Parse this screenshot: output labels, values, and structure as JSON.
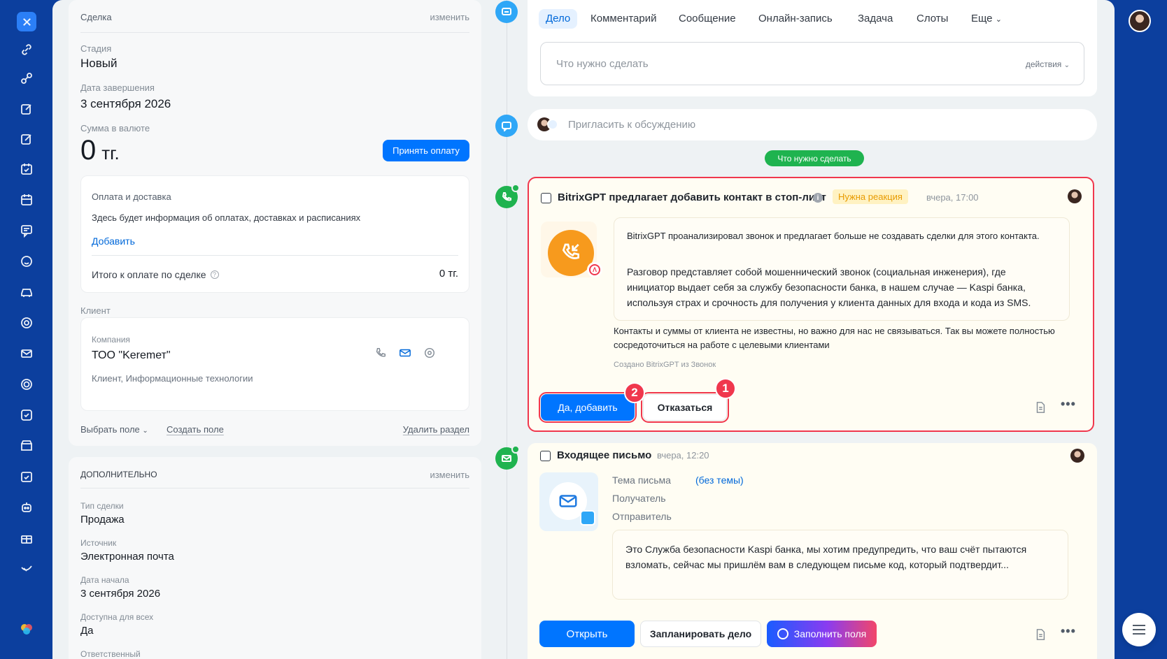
{
  "nav": {
    "icons": [
      "close-icon",
      "link-icon",
      "link-alt-icon",
      "edit-icon",
      "edit-alt-icon",
      "calendar-task-icon",
      "calendar-icon",
      "chat-icon",
      "feedback-icon",
      "car-icon",
      "support-icon",
      "mail-icon",
      "target-icon",
      "checklist-icon",
      "store-icon",
      "tasks-icon",
      "robot-icon",
      "gift-icon",
      "bird-icon",
      "bitrix-logo-icon"
    ]
  },
  "deal": {
    "section_title": "Сделка",
    "edit_label": "изменить",
    "stage_label": "Стадия",
    "stage_value": "Новый",
    "close_date_label": "Дата завершения",
    "close_date_value": "3 сентября 2026",
    "amount_label": "Сумма в валюте",
    "amount_value": "0",
    "amount_currency": "тг.",
    "accept_payment_button": "Принять оплату",
    "payment": {
      "title": "Оплата и доставка",
      "description": "Здесь будет информация об оплатах, доставках и расписаниях",
      "add_link": "Добавить",
      "total_label": "Итого к оплате по сделке",
      "total_value": "0 тг."
    },
    "client_label": "Клиент",
    "client": {
      "type_label": "Компания",
      "name": "ТОО \"Keremет\"",
      "description": "Клиент, Информационные технологии"
    },
    "select_field": "Выбрать поле",
    "create_field": "Создать поле",
    "delete_section": "Удалить раздел"
  },
  "extra": {
    "section_title": "ДОПОЛНИТЕЛЬНО",
    "edit_label": "изменить",
    "deal_type_label": "Тип сделки",
    "deal_type_value": "Продажа",
    "source_label": "Источник",
    "source_value": "Электронная почта",
    "start_date_label": "Дата начала",
    "start_date_value": "3 сентября 2026",
    "available_label": "Доступна для всех",
    "available_value": "Да",
    "responsible_label": "Ответственный"
  },
  "editor": {
    "tabs": [
      "Дело",
      "Комментарий",
      "Сообщение",
      "Онлайн-запись",
      "Задача",
      "Слоты",
      "Еще"
    ],
    "todo_placeholder": "Что нужно сделать",
    "actions_label": "действия",
    "invite_placeholder": "Пригласить к обсуждению"
  },
  "todo_pill": "Что нужно сделать",
  "activity_gpt": {
    "title": "BitrixGPT предлагает добавить контакт в стоп-лист",
    "badge": "Нужна реакция",
    "time": "вчера, 17:00",
    "para1": "BitrixGPT проанализировал звонок и предлагает больше не создавать сделки для этого контакта.",
    "para2": "Разговор представляет собой мошеннический звонок (социальная инженерия), где инициатор выдает себя за службу безопасности банка, в нашем случае — Kaspi банка, используя страх и срочность для получения у клиента данных для входа и кода из SMS.",
    "note": "Контакты и суммы от клиента не известны, но важно для нас не связываться. Так вы можете полностью сосредоточиться на работе с целевыми клиентами",
    "created_by": "Создано BitrixGPT из Звонок",
    "accept_button": "Да, добавить",
    "decline_button": "Отказаться",
    "marker_accept": "2",
    "marker_decline": "1"
  },
  "activity_mail": {
    "title": "Входящее письмо",
    "time": "вчера, 12:20",
    "subject_label": "Тема письма",
    "subject_value": "(без темы)",
    "recipient_label": "Получатель",
    "sender_label": "Отправитель",
    "body": "Это Служба безопасности Kaspi банка, мы хотим предупредить, что ваш счёт пытаются взломать, сейчас мы пришлём вам в следующем письме код, который подтвердит...",
    "open_button": "Открыть",
    "schedule_button": "Запланировать дело",
    "fill_button": "Заполнить поля"
  },
  "colors": {
    "rail": "#0c3f9e",
    "accent": "#0075ff",
    "green": "#1fb34f",
    "alert": "#f0374d",
    "badge_text": "#e89b00"
  }
}
